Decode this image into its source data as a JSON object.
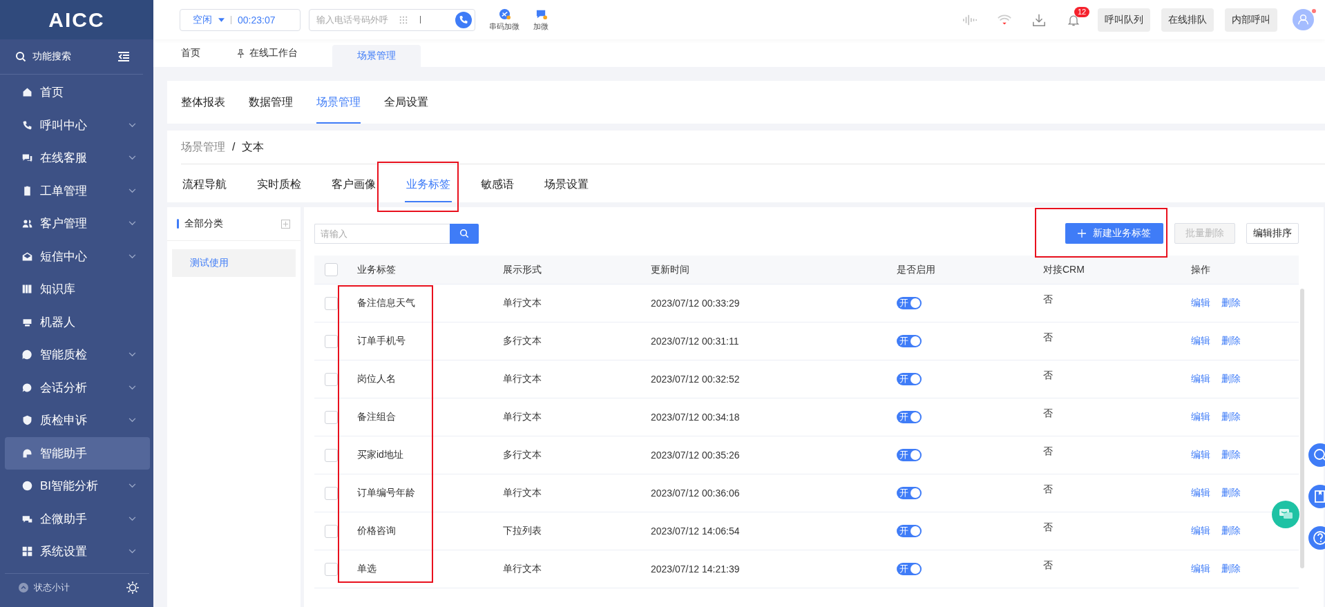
{
  "logo": "AICC",
  "topbar": {
    "status": "空闲",
    "timer": "00:23:07",
    "phone_placeholder": "输入电话号码外呼",
    "tools": [
      {
        "label": "串码加微"
      },
      {
        "label": "加微"
      }
    ],
    "notification_count": "12",
    "buttons": [
      "呼叫队列",
      "在线排队",
      "内部呼叫"
    ],
    "avatar_dot": true
  },
  "sidebar": {
    "search": "功能搜索",
    "items": [
      {
        "label": "首页",
        "expandable": false,
        "selected": false
      },
      {
        "label": "呼叫中心",
        "expandable": true,
        "selected": false
      },
      {
        "label": "在线客服",
        "expandable": true,
        "selected": false
      },
      {
        "label": "工单管理",
        "expandable": true,
        "selected": false
      },
      {
        "label": "客户管理",
        "expandable": true,
        "selected": false
      },
      {
        "label": "短信中心",
        "expandable": true,
        "selected": false
      },
      {
        "label": "知识库",
        "expandable": false,
        "selected": false
      },
      {
        "label": "机器人",
        "expandable": false,
        "selected": false
      },
      {
        "label": "智能质检",
        "expandable": true,
        "selected": false
      },
      {
        "label": "会话分析",
        "expandable": true,
        "selected": false
      },
      {
        "label": "质检申诉",
        "expandable": true,
        "selected": false
      },
      {
        "label": "智能助手",
        "expandable": false,
        "selected": true
      },
      {
        "label": "BI智能分析",
        "expandable": true,
        "selected": false
      },
      {
        "label": "企微助手",
        "expandable": true,
        "selected": false
      },
      {
        "label": "系统设置",
        "expandable": true,
        "selected": false
      }
    ],
    "footer": "状态小计"
  },
  "page_tabs": [
    {
      "label": "首页",
      "pinned": false,
      "selected": false
    },
    {
      "label": "在线工作台",
      "pinned": true,
      "selected": false
    },
    {
      "label": "场景管理",
      "pinned": false,
      "selected": true
    }
  ],
  "top_tabs": [
    {
      "label": "整体报表",
      "selected": false
    },
    {
      "label": "数据管理",
      "selected": false
    },
    {
      "label": "场景管理",
      "selected": true
    },
    {
      "label": "全局设置",
      "selected": false
    }
  ],
  "breadcrumb": {
    "items": [
      "场景管理",
      "文本"
    ],
    "separator": "/"
  },
  "sub_tabs": [
    {
      "label": "流程导航",
      "selected": false
    },
    {
      "label": "实时质检",
      "selected": false
    },
    {
      "label": "客户画像",
      "selected": false
    },
    {
      "label": "业务标签",
      "selected": true
    },
    {
      "label": "敏感语",
      "selected": false
    },
    {
      "label": "场景设置",
      "selected": false
    }
  ],
  "categories": {
    "title": "全部分类",
    "items": [
      {
        "label": "测试使用",
        "selected": true
      }
    ]
  },
  "toolbar": {
    "search_placeholder": "请输入",
    "buttons": [
      {
        "label": "新建业务标签",
        "kind": "primary",
        "disabled": false
      },
      {
        "label": "批量删除",
        "kind": "plain",
        "disabled": true
      },
      {
        "label": "编辑排序",
        "kind": "plain",
        "disabled": false
      }
    ]
  },
  "table": {
    "all_checked": false,
    "columns": [
      "业务标签",
      "展示形式",
      "更新时间",
      "是否启用",
      "对接CRM",
      "操作"
    ],
    "rows": [
      {
        "checked": false,
        "name": "备注信息天气",
        "display": "单行文本",
        "updated": "2023/07/12 00:33:29",
        "enabled": true,
        "toggle_label": "开",
        "crm": "否",
        "actions": [
          "编辑",
          "删除"
        ]
      },
      {
        "checked": false,
        "name": "订单手机号",
        "display": "多行文本",
        "updated": "2023/07/12 00:31:11",
        "enabled": true,
        "toggle_label": "开",
        "crm": "否",
        "actions": [
          "编辑",
          "删除"
        ]
      },
      {
        "checked": false,
        "name": "岗位人名",
        "display": "单行文本",
        "updated": "2023/07/12 00:32:52",
        "enabled": true,
        "toggle_label": "开",
        "crm": "否",
        "actions": [
          "编辑",
          "删除"
        ]
      },
      {
        "checked": false,
        "name": "备注组合",
        "display": "单行文本",
        "updated": "2023/07/12 00:34:18",
        "enabled": true,
        "toggle_label": "开",
        "crm": "否",
        "actions": [
          "编辑",
          "删除"
        ]
      },
      {
        "checked": false,
        "name": "买家id地址",
        "display": "多行文本",
        "updated": "2023/07/12 00:35:26",
        "enabled": true,
        "toggle_label": "开",
        "crm": "否",
        "actions": [
          "编辑",
          "删除"
        ]
      },
      {
        "checked": false,
        "name": "订单编号年龄",
        "display": "单行文本",
        "updated": "2023/07/12 00:36:06",
        "enabled": true,
        "toggle_label": "开",
        "crm": "否",
        "actions": [
          "编辑",
          "删除"
        ]
      },
      {
        "checked": false,
        "name": "价格咨询",
        "display": "下拉列表",
        "updated": "2023/07/12 14:06:54",
        "enabled": true,
        "toggle_label": "开",
        "crm": "否",
        "actions": [
          "编辑",
          "删除"
        ]
      },
      {
        "checked": false,
        "name": "单选",
        "display": "单行文本",
        "updated": "2023/07/12 14:21:39",
        "enabled": true,
        "toggle_label": "开",
        "crm": "否",
        "actions": [
          "编辑",
          "删除"
        ]
      }
    ]
  }
}
